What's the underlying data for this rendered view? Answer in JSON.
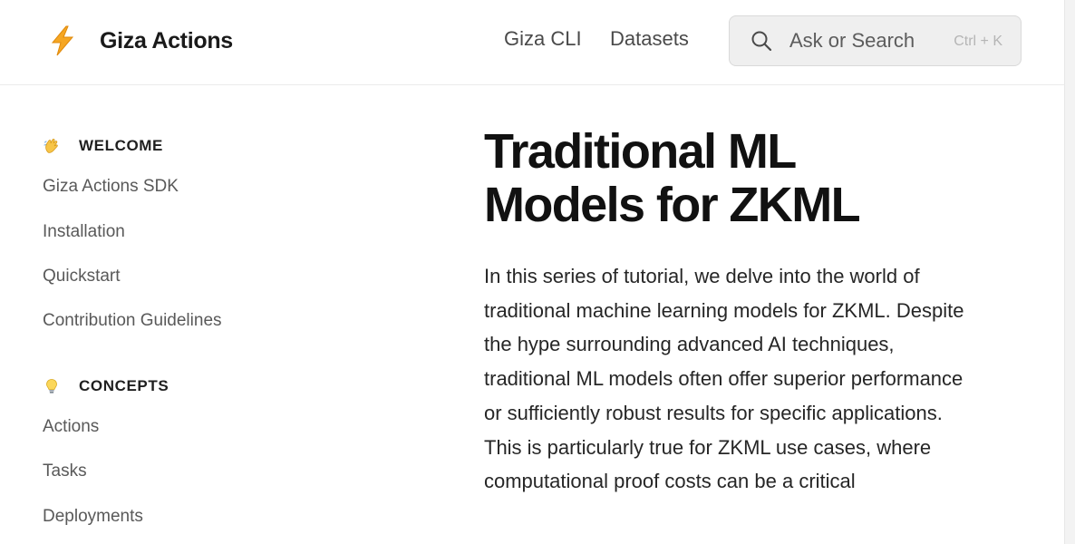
{
  "header": {
    "brand": {
      "title": "Giza Actions",
      "icon": "lightning-bolt-icon"
    },
    "nav": [
      {
        "label": "Giza CLI"
      },
      {
        "label": "Datasets"
      }
    ],
    "search": {
      "placeholder": "Ask or Search",
      "shortcut": "Ctrl + K",
      "icon": "search-icon"
    }
  },
  "sidebar": {
    "sections": [
      {
        "title": "WELCOME",
        "emoji": "waving-hand-icon",
        "items": [
          {
            "label": "Giza Actions SDK"
          },
          {
            "label": "Installation"
          },
          {
            "label": "Quickstart"
          },
          {
            "label": "Contribution Guidelines"
          }
        ]
      },
      {
        "title": "CONCEPTS",
        "emoji": "light-bulb-icon",
        "items": [
          {
            "label": "Actions"
          },
          {
            "label": "Tasks"
          },
          {
            "label": "Deployments"
          }
        ]
      }
    ]
  },
  "main": {
    "title": "Traditional ML Models for ZKML",
    "body": "In this series of tutorial, we delve into the world of traditional machine learning models for ZKML. Despite the hype surrounding advanced AI techniques, traditional ML models often offer superior performance or sufficiently robust results for specific applications. This is particularly true for ZKML use cases, where computational proof costs can be a critical"
  },
  "colors": {
    "brand_bolt": "#f5a623",
    "text_primary": "#1f1f1f",
    "text_secondary": "#595959",
    "search_bg": "#efefef"
  }
}
